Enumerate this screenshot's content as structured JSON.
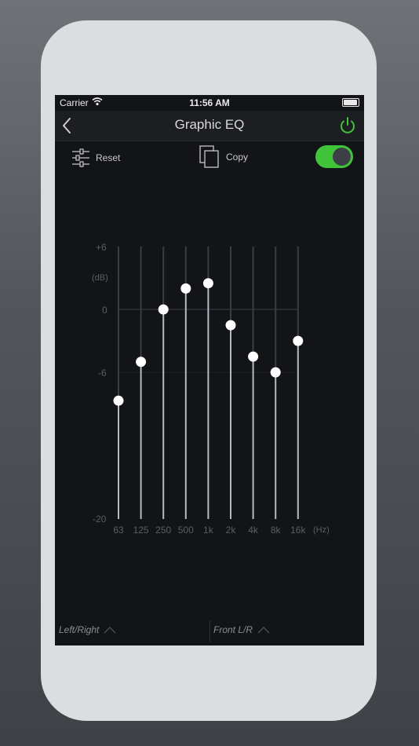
{
  "status": {
    "carrier": "Carrier",
    "time": "11:56 AM"
  },
  "nav": {
    "title": "Graphic EQ"
  },
  "toolbar": {
    "reset_label": "Reset",
    "copy_label": "Copy",
    "toggle_on": true
  },
  "eq": {
    "db_unit": "(dB)",
    "hz_unit": "(Hz)",
    "db_ticks": [
      "+6",
      "0",
      "-6",
      "-20"
    ],
    "bands": [
      {
        "freq": "63",
        "gain_db": -8.7
      },
      {
        "freq": "125",
        "gain_db": -5.0
      },
      {
        "freq": "250",
        "gain_db": 0.0
      },
      {
        "freq": "500",
        "gain_db": 2.0
      },
      {
        "freq": "1k",
        "gain_db": 2.5
      },
      {
        "freq": "2k",
        "gain_db": -1.5
      },
      {
        "freq": "4k",
        "gain_db": -4.5
      },
      {
        "freq": "8k",
        "gain_db": -6.0
      },
      {
        "freq": "16k",
        "gain_db": -3.0
      }
    ]
  },
  "bottom": {
    "left_label": "Left/Right",
    "right_label": "Front L/R"
  },
  "colors": {
    "accent_green": "#3fc43a",
    "slider_track": "#b6b9c4",
    "knob": "#ffffff"
  }
}
